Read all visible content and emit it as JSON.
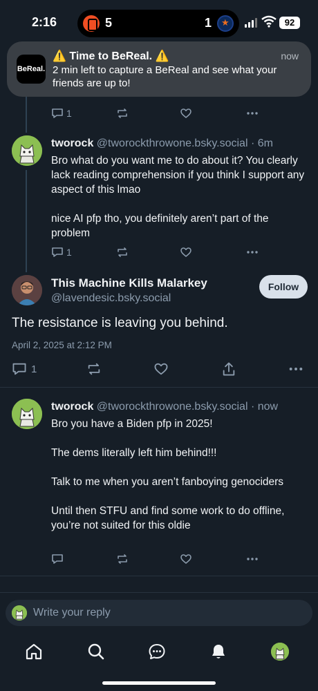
{
  "status_bar": {
    "time": "2:16",
    "score_left": "5",
    "score_right": "1",
    "battery": "92"
  },
  "notification": {
    "app_icon_text": "BeReal.",
    "title": "⚠️ Time to BeReal. ⚠️",
    "time": "now",
    "body": "2 min left to capture a BeReal and see what your friends are up to!"
  },
  "posts": [
    {
      "actions": {
        "replies": "1"
      }
    },
    {
      "display_name": "tworock",
      "handle": "@tworockthrowone.bsky.social",
      "time": "· 6m",
      "paragraphs": [
        "Bro what do you want me to do about it? You clearly lack reading comprehension if you think I support any aspect of this lmao",
        "nice AI pfp tho, you definitely aren’t part of the problem"
      ],
      "actions": {
        "replies": "1"
      }
    }
  ],
  "focused_post": {
    "display_name": "This Machine Kills Malarkey",
    "handle": "@lavendesic.bsky.social",
    "follow_label": "Follow",
    "text": "The resistance is leaving you behind.",
    "date": "April 2, 2025 at 2:12 PM",
    "replies": "1"
  },
  "reply": {
    "display_name": "tworock",
    "handle": "@tworockthrowone.bsky.social",
    "time": "· now",
    "paragraphs": [
      "Bro you have a Biden pfp in 2025!",
      "The dems literally left him behind!!!",
      "Talk to me when you aren’t fanboying genociders",
      "Until then STFU and find some work to do offline, you’re not suited for this oldie"
    ]
  },
  "composer": {
    "placeholder": "Write your reply"
  },
  "colors": {
    "background": "#161e27",
    "muted_text": "#8c9cad",
    "follow_button": "#d9e1ea"
  }
}
